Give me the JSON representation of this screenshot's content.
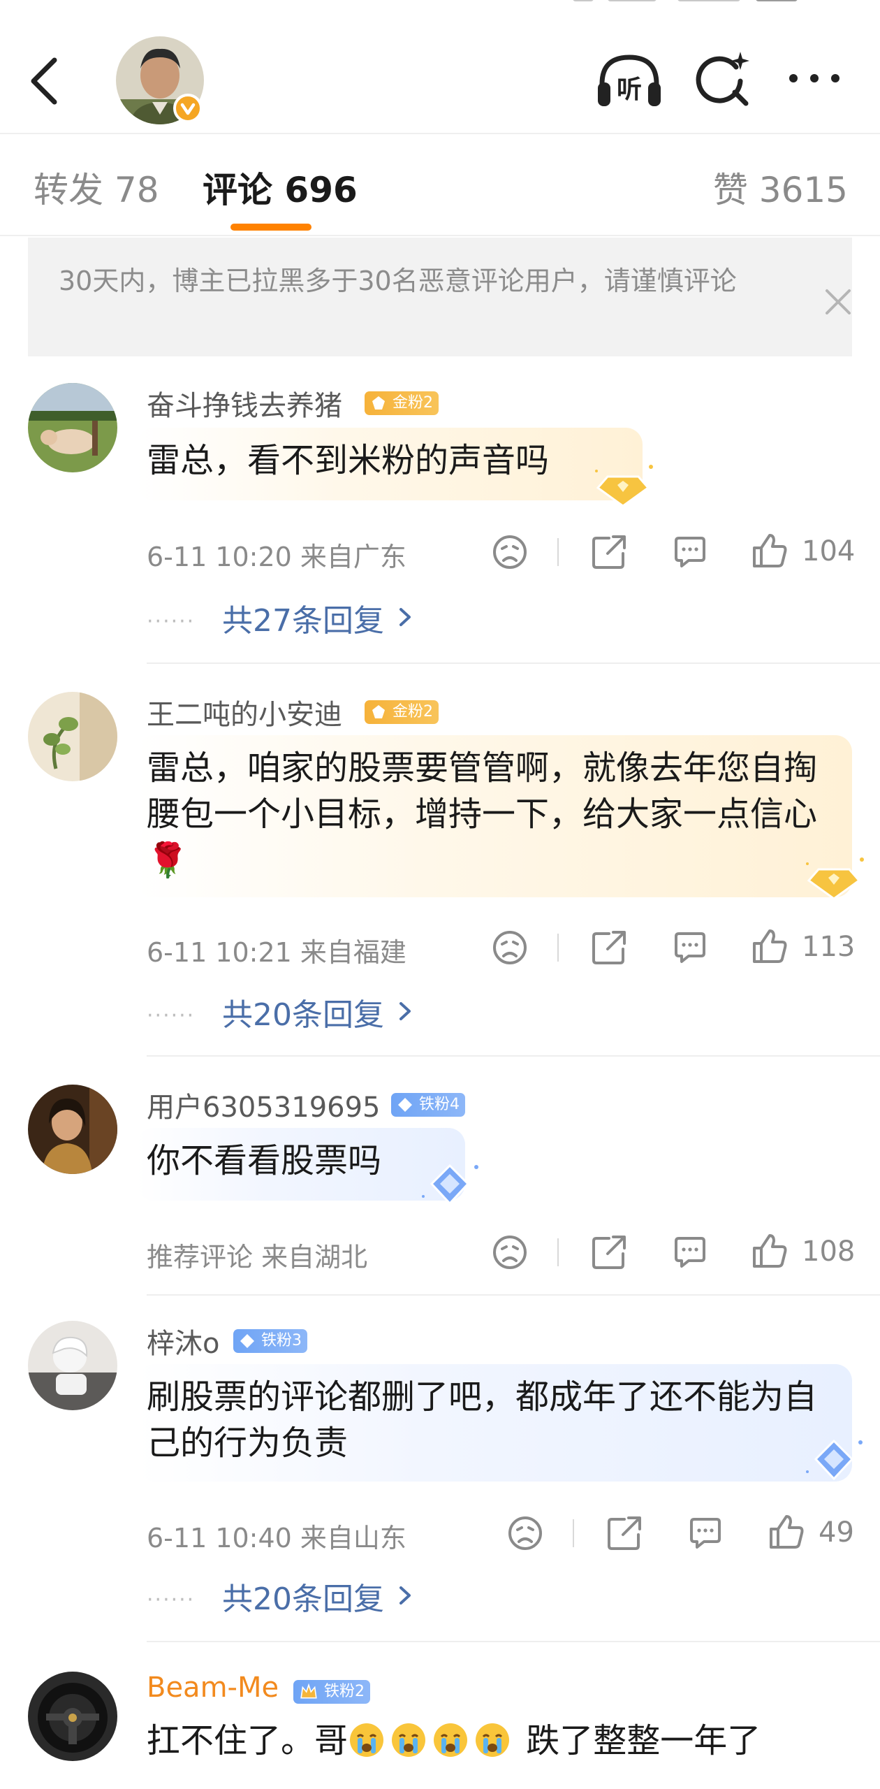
{
  "header": {
    "back_icon": "chevron-left-icon",
    "listen_icon": "headphones-listen-icon",
    "listen_label": "听",
    "search_icon": "search-sparkle-icon",
    "more_icon": "more-dots-icon",
    "verified_color": "#f5a623"
  },
  "tabs": {
    "repost": "转发 78",
    "comments": "评论 696",
    "likes": "赞 3615",
    "accent": "#ff8200"
  },
  "notice": {
    "text": "30天内，博主已拉黑多于30名恶意评论用户，请谨慎评论"
  },
  "comments": [
    {
      "username": "奋斗挣钱去养猪",
      "badge": "金粉2",
      "text": "雷总，看不到米粉的声音吗",
      "meta": "6-11 10:20  来自广东",
      "likes": "104",
      "replies": "共27条回复"
    },
    {
      "username": "王二吨的小安迪",
      "badge": "金粉2",
      "text": "雷总，咱家的股票要管管啊，就像去年您自掏腰包一个小目标，增持一下，给大家一点信心🌹",
      "meta": "6-11 10:21  来自福建",
      "likes": "113",
      "replies": "共20条回复"
    },
    {
      "username": "用户6305319695",
      "badge": "铁粉4",
      "text": "你不看看股票吗",
      "meta": "推荐评论  来自湖北",
      "likes": "108"
    },
    {
      "username": "梓沐o",
      "badge": "铁粉3",
      "text": "刷股票的评论都删了吧，都成年了还不能为自己的行为负责",
      "meta": "6-11 10:40  来自山东",
      "likes": "49",
      "replies": "共20条回复"
    },
    {
      "username": "Beam-Me",
      "badge": "铁粉2",
      "text_a": "扛不住了。哥",
      "text_b": "跌了整整一年了"
    }
  ],
  "actions": {
    "dislike_icon": "sad-face-icon",
    "share_icon": "share-icon",
    "comment_icon": "comment-icon",
    "like_icon": "thumbs-up-icon"
  }
}
